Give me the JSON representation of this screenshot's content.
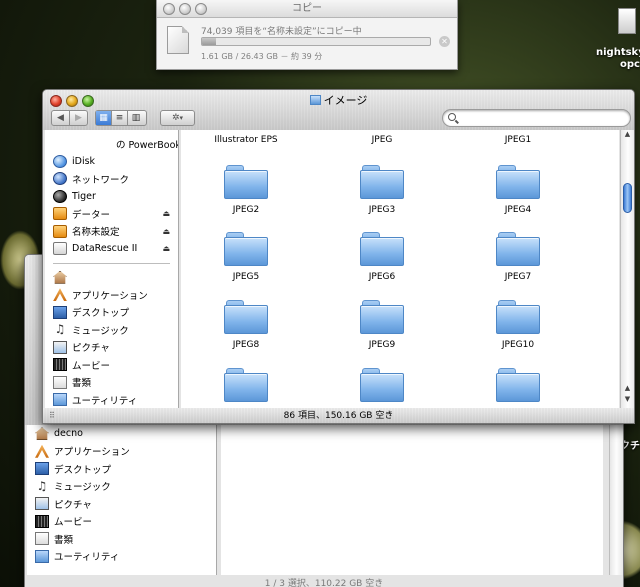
{
  "copy_window": {
    "title": "コピー",
    "status": "74,039 項目を“名称未設定”にコピー中",
    "progress": "1.61 GB / 26.43 GB － 約 39 分",
    "progress_fraction": 0.06
  },
  "desktop": {
    "icon_label_1": "nightsky_l",
    "icon_label_2": "opc",
    "icon_label_3": "ピクチ"
  },
  "front_window": {
    "title": "イメージ",
    "sidebar_items": [
      {
        "label": "の PowerBook",
        "icon": "harddisk-icon"
      },
      {
        "label": "iDisk",
        "icon": "idisk-icon"
      },
      {
        "label": "ネットワーク",
        "icon": "network-globe-icon"
      },
      {
        "label": "Tiger",
        "icon": "macosx-disk-icon"
      },
      {
        "label": "データー",
        "icon": "external-disk-icon",
        "eject": "⏏"
      },
      {
        "label": "名称未設定",
        "icon": "external-disk-icon",
        "eject": "⏏"
      },
      {
        "label": "DataRescue II",
        "icon": "cd-disk-icon",
        "eject": "⏏"
      }
    ],
    "places": [
      {
        "label": "",
        "icon": "home-icon"
      },
      {
        "label": "アプリケーション",
        "icon": "applications-icon"
      },
      {
        "label": "デスクトップ",
        "icon": "desktop-icon"
      },
      {
        "label": "ミュージック",
        "icon": "music-icon"
      },
      {
        "label": "ピクチャ",
        "icon": "pictures-icon"
      },
      {
        "label": "ムービー",
        "icon": "movies-icon"
      },
      {
        "label": "書類",
        "icon": "documents-icon"
      },
      {
        "label": "ユーティリティ",
        "icon": "utilities-icon"
      }
    ],
    "folders": [
      "Illustrator EPS",
      "JPEG",
      "JPEG1",
      "JPEG2",
      "JPEG3",
      "JPEG4",
      "JPEG5",
      "JPEG6",
      "JPEG7",
      "JPEG8",
      "JPEG9",
      "JPEG10",
      "",
      "",
      ""
    ],
    "status": "86 項目、150.16 GB 空き"
  },
  "back_window": {
    "sidebar_items": [
      {
        "label": "decno",
        "icon": "home-icon"
      },
      {
        "label": "アプリケーション",
        "icon": "applications-icon"
      },
      {
        "label": "デスクトップ",
        "icon": "desktop-icon"
      },
      {
        "label": "ミュージック",
        "icon": "music-icon"
      },
      {
        "label": "ピクチャ",
        "icon": "pictures-icon"
      },
      {
        "label": "ムービー",
        "icon": "movies-icon"
      },
      {
        "label": "書類",
        "icon": "documents-icon"
      },
      {
        "label": "ユーティリティ",
        "icon": "utilities-icon"
      }
    ],
    "status": "1 / 3 選択、110.22 GB 空き"
  }
}
